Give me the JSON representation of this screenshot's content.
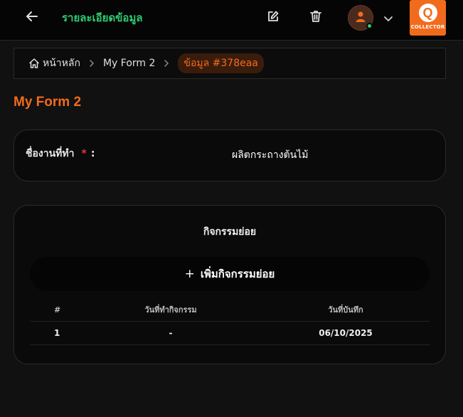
{
  "header": {
    "title": "รายละเอียดข้อมูล",
    "logo_text": "COLLECTOR",
    "logo_letter": "Q",
    "icons": {
      "back": "arrow-left-icon",
      "edit": "edit-icon",
      "delete": "trash-icon",
      "user": "user-icon",
      "menu": "chevron-down-icon"
    }
  },
  "breadcrumb": {
    "home": "หน้าหลัก",
    "form": "My Form 2",
    "current": "ข้อมูล #378eaa"
  },
  "form": {
    "title": "My Form 2",
    "field": {
      "label": "ชื่องานที่ทำ",
      "required_mark": "*",
      "colon": ":",
      "value": "ผลิตกระถางต้นไม้"
    }
  },
  "subactivities": {
    "title": "กิจกรรมย่อย",
    "add_plus": "+",
    "add_label": "เพิ่มกิจกรรมย่อย",
    "columns": [
      "#",
      "วันที่ทำกิจกรรม",
      "วันที่บันทึก"
    ],
    "rows": [
      [
        "1",
        "-",
        "06/10/2025"
      ]
    ]
  },
  "colors": {
    "accent": "#f26b1d",
    "title_green": "#2ecc71",
    "required": "#e53935",
    "background": "#111111"
  }
}
